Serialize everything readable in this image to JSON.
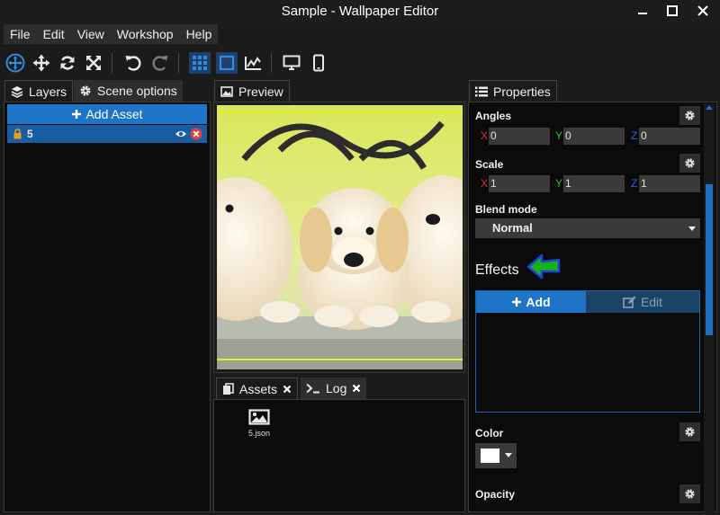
{
  "window": {
    "title": "Sample - Wallpaper Editor"
  },
  "menu": [
    "File",
    "Edit",
    "View",
    "Workshop",
    "Help"
  ],
  "toolbar": {
    "icons": [
      "move-gizmo-icon",
      "move-icon",
      "rotate-icon",
      "scale-icon",
      "undo-icon",
      "redo-icon",
      "grid-icon",
      "frame-icon",
      "chart-icon",
      "desktop-icon",
      "mobile-icon"
    ]
  },
  "left": {
    "tabs": [
      "Layers",
      "Scene options"
    ],
    "add_asset": "Add Asset",
    "layer": {
      "name": "5"
    }
  },
  "preview": {
    "tab": "Preview"
  },
  "bottom": {
    "tabs": [
      "Assets",
      "Log"
    ],
    "file": {
      "name": "5.json"
    }
  },
  "properties": {
    "tab": "Properties",
    "angles": {
      "label": "Angles",
      "x": "0",
      "y": "0",
      "z": "0"
    },
    "scale": {
      "label": "Scale",
      "x": "1",
      "y": "1",
      "z": "1"
    },
    "axis": {
      "x": "X",
      "y": "Y",
      "z": "Z"
    },
    "blend": {
      "label": "Blend mode",
      "value": "Normal"
    },
    "effects": {
      "title": "Effects",
      "add": "Add",
      "edit": "Edit"
    },
    "color": {
      "label": "Color",
      "value": "#ffffff"
    },
    "opacity": {
      "label": "Opacity"
    }
  },
  "colors": {
    "accent": "#1e74c6",
    "selection": "#175ea3",
    "axis_x": "#e03030",
    "axis_y": "#30c030",
    "axis_z": "#3060e0"
  }
}
